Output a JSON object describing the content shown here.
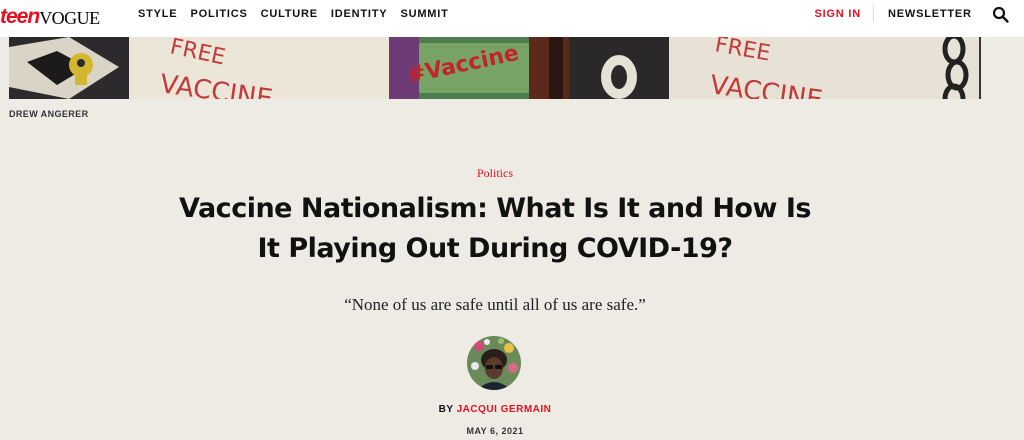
{
  "header": {
    "logo_teen": "teen",
    "logo_vogue": "VOGUE",
    "nav": [
      {
        "label": "STYLE"
      },
      {
        "label": "POLITICS"
      },
      {
        "label": "CULTURE"
      },
      {
        "label": "IDENTITY"
      },
      {
        "label": "SUMMIT"
      }
    ],
    "sign_in": "SIGN IN",
    "newsletter": "NEWSLETTER",
    "search_icon": "search-icon"
  },
  "hero": {
    "sign_text_1": "FREE",
    "sign_text_2": "VACCINE",
    "sign_text_3": "#Vaccine",
    "sign_text_4": "FREE",
    "sign_text_5": "VACCINE",
    "credit": "DREW ANGERER"
  },
  "article": {
    "category": "Politics",
    "headline_line1": "Vaccine Nationalism: What Is It and How Is",
    "headline_line2": "It Playing Out During COVID-19?",
    "dek": "“None of us are safe until all of us are safe.”",
    "byline_prefix": "BY",
    "author": "JACQUI GERMAIN",
    "date": "MAY 6, 2021"
  },
  "colors": {
    "brand_red": "#e4101f",
    "background": "#edebe4",
    "header_bg": "#ffffff"
  }
}
